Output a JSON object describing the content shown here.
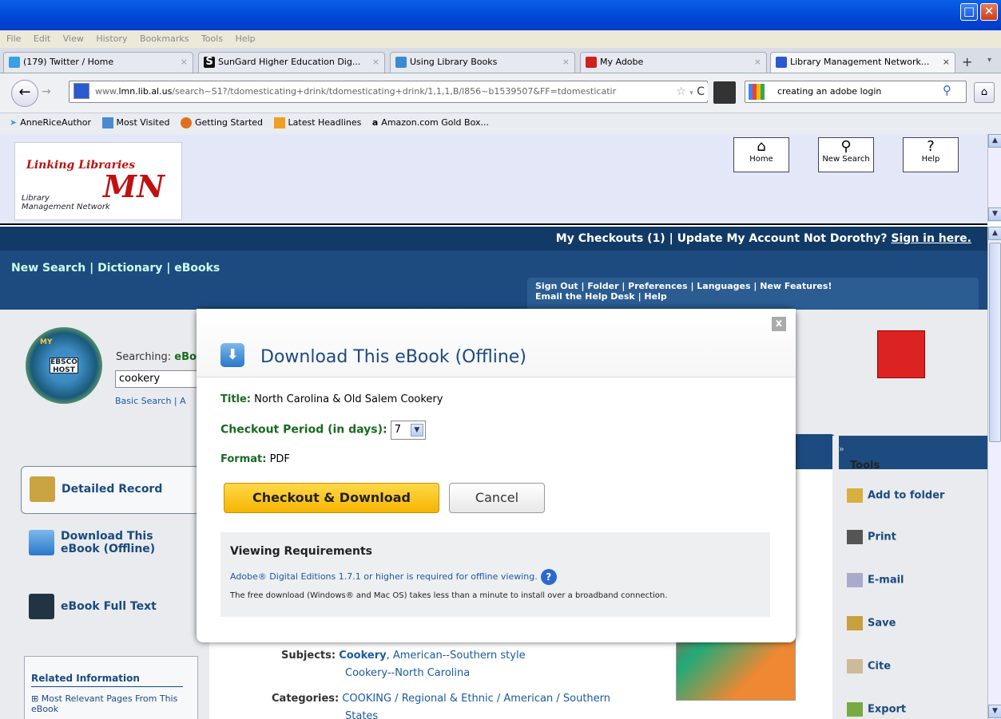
{
  "menu": [
    "File",
    "Edit",
    "View",
    "History",
    "Bookmarks",
    "Tools",
    "Help"
  ],
  "tabs": [
    {
      "label": "(179) Twitter / Home",
      "icon": "twitter-icon"
    },
    {
      "label": "SunGard Higher Education Dig...",
      "icon": "sungard-icon"
    },
    {
      "label": "Using Library Books",
      "icon": "library-icon"
    },
    {
      "label": "My Adobe",
      "icon": "adobe-icon"
    },
    {
      "label": "Library Management Network...",
      "icon": "lmn-icon"
    }
  ],
  "url": {
    "prefix": "www.",
    "domain": "lmn.lib.al.us",
    "rest": "/search~S1?/tdomesticating+drink/tdomesticating+drink/1,1,1,B/l856~b1539507&FF=tdomesticatir"
  },
  "search_query": "creating an adobe login",
  "bookmarks": [
    "AnneRiceAuthor",
    "Most Visited",
    "Getting Started",
    "Latest Headlines",
    "Amazon.com Gold Box..."
  ],
  "lmn": {
    "logo_text_1": "Linking Libraries",
    "logo_text_2": "Library",
    "logo_text_3": "Management Network",
    "home": "Home",
    "new_search": "New Search",
    "help": "Help"
  },
  "ebsco": {
    "top_links": "My Checkouts (1)  |  Update My Account   Not Dorothy?",
    "sign_in": "Sign in here.",
    "nav": "New Search  |  Dictionary  |  eBooks",
    "util_1": "Sign Out  |  Folder  |  Preferences  |  Languages  |  New Features!",
    "util_2": "Email the Help Desk  |  Help",
    "searching_label": "Searching:",
    "searching_value": "eBo",
    "search_value": "cookery",
    "basic_search": "Basic Search  |  A",
    "logo_my": "MY",
    "logo_ebsco": "EBSCO",
    "logo_host": "HOST"
  },
  "left_items": [
    "Detailed Record",
    "Download This eBook (Offline)",
    "eBook Full Text"
  ],
  "related": {
    "heading": "Related Information",
    "item": "Most Relevant Pages From This eBook"
  },
  "detail": {
    "subjects_label": "Subjects:",
    "subjects_link": "Cookery",
    "subjects_rest": ", American--Southern style",
    "subjects_2": "Cookery--North Carolina",
    "categories_label": "Categories:",
    "categories_1": "COOKING / Regional & Ethnic / American / Southern",
    "categories_2": "States"
  },
  "tools": {
    "heading": "Tools",
    "items": [
      "Add to folder",
      "Print",
      "E-mail",
      "Save",
      "Cite",
      "Export"
    ]
  },
  "modal": {
    "title": "Download This eBook (Offline)",
    "title_label": "Title:",
    "title_value": "North Carolina & Old Salem Cookery",
    "period_label": "Checkout Period (in days):",
    "period_value": "7",
    "format_label": "Format:",
    "format_value": "PDF",
    "checkout_button": "Checkout & Download",
    "cancel_button": "Cancel",
    "req_heading": "Viewing Requirements",
    "req_link": "Adobe® Digital Editions 1.7.1 or higher is required for offline viewing.",
    "req_text": "The free download (Windows® and Mac OS) takes less than a minute to install over a broadband connection.",
    "close": "x"
  }
}
